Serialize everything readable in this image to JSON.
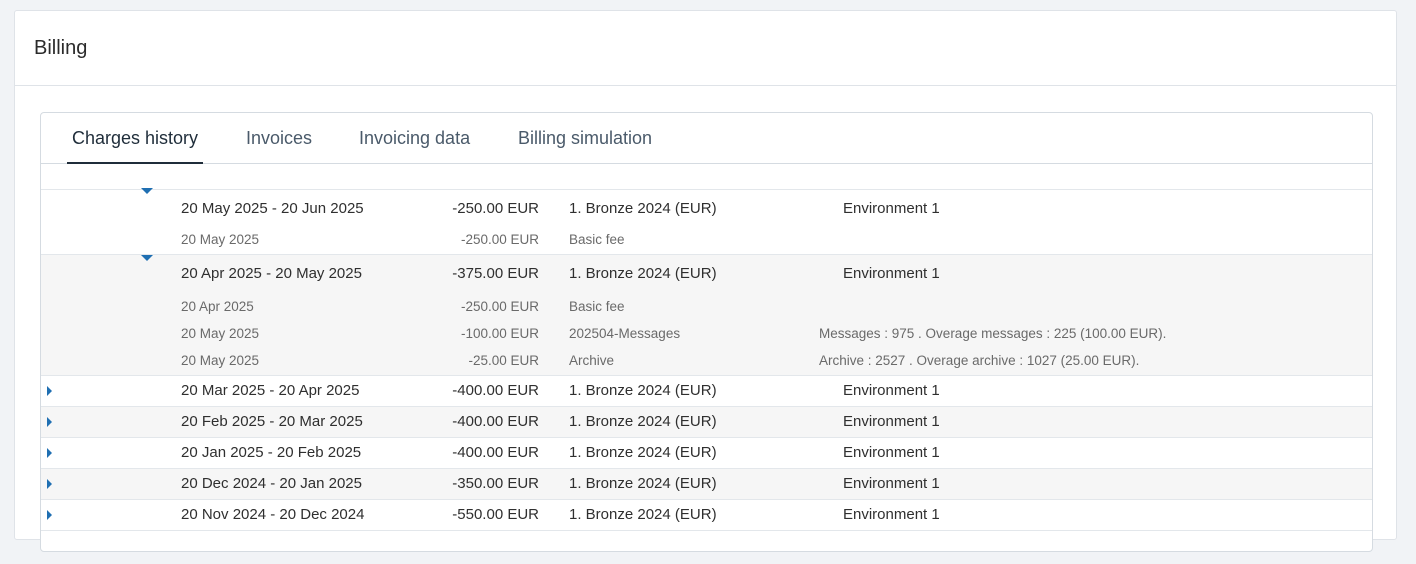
{
  "header": {
    "title": "Billing"
  },
  "tabs": [
    {
      "label": "Charges history",
      "active": true
    },
    {
      "label": "Invoices",
      "active": false
    },
    {
      "label": "Invoicing data",
      "active": false
    },
    {
      "label": "Billing simulation",
      "active": false
    }
  ],
  "colors": {
    "accent": "#1f6fb2",
    "shaded_row": "#f6f6f6"
  },
  "periods": [
    {
      "period": "20 May 2025 - 20 Jun 2025",
      "amount": "-250.00 EUR",
      "plan": "1. Bronze 2024 (EUR)",
      "environment": "Environment 1",
      "expanded": true,
      "details": [
        {
          "date": "20 May 2025",
          "amount": "-250.00 EUR",
          "item": "Basic fee",
          "note": ""
        }
      ]
    },
    {
      "period": "20 Apr 2025 - 20 May 2025",
      "amount": "-375.00 EUR",
      "plan": "1. Bronze 2024 (EUR)",
      "environment": "Environment 1",
      "expanded": true,
      "details": [
        {
          "date": "20 Apr 2025",
          "amount": "-250.00 EUR",
          "item": "Basic fee",
          "note": ""
        },
        {
          "date": "20 May 2025",
          "amount": "-100.00 EUR",
          "item": "202504-Messages",
          "note": "Messages : 975 . Overage messages : 225 (100.00 EUR)."
        },
        {
          "date": "20 May 2025",
          "amount": "-25.00 EUR",
          "item": "Archive",
          "note": "Archive : 2527 . Overage archive : 1027 (25.00 EUR)."
        }
      ]
    },
    {
      "period": "20 Mar 2025 - 20 Apr 2025",
      "amount": "-400.00 EUR",
      "plan": "1. Bronze 2024 (EUR)",
      "environment": "Environment 1",
      "expanded": false,
      "details": []
    },
    {
      "period": "20 Feb 2025 - 20 Mar 2025",
      "amount": "-400.00 EUR",
      "plan": "1. Bronze 2024 (EUR)",
      "environment": "Environment 1",
      "expanded": false,
      "details": []
    },
    {
      "period": "20 Jan 2025 - 20 Feb 2025",
      "amount": "-400.00 EUR",
      "plan": "1. Bronze 2024 (EUR)",
      "environment": "Environment 1",
      "expanded": false,
      "details": []
    },
    {
      "period": "20 Dec 2024 - 20 Jan 2025",
      "amount": "-350.00 EUR",
      "plan": "1. Bronze 2024 (EUR)",
      "environment": "Environment 1",
      "expanded": false,
      "details": []
    },
    {
      "period": "20 Nov 2024 - 20 Dec 2024",
      "amount": "-550.00 EUR",
      "plan": "1. Bronze 2024 (EUR)",
      "environment": "Environment 1",
      "expanded": false,
      "details": []
    }
  ]
}
